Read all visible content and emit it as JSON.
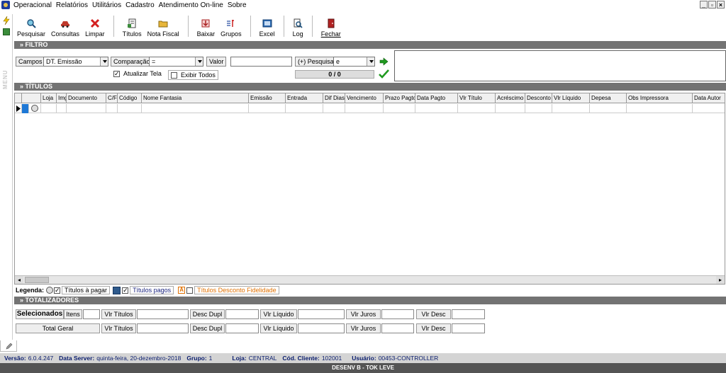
{
  "menu": {
    "items": [
      "Operacional",
      "Relatórios",
      "Utilitários",
      "Cadastro",
      "Atendimento On-line",
      "Sobre"
    ],
    "window_controls": [
      "_",
      "▫",
      "×"
    ]
  },
  "left_strip": {
    "vertical_label": "MENU"
  },
  "toolbar": {
    "groups": [
      [
        {
          "name": "pesquisar",
          "label": "Pesquisar",
          "icon": "search-icon"
        },
        {
          "name": "consultas",
          "label": "Consultas",
          "icon": "car-icon"
        },
        {
          "name": "limpar",
          "label": "Limpar",
          "icon": "red-x-icon"
        }
      ],
      [
        {
          "name": "titulos",
          "label": "Títulos",
          "icon": "document-icon"
        },
        {
          "name": "nota-fiscal",
          "label": "Nota Fiscal",
          "icon": "folder-icon"
        }
      ],
      [
        {
          "name": "baixar",
          "label": "Baixar",
          "icon": "download-icon"
        },
        {
          "name": "grupos",
          "label": "Grupos",
          "icon": "group-icon"
        }
      ],
      [
        {
          "name": "excel",
          "label": "Excel",
          "icon": "excel-icon"
        }
      ],
      [
        {
          "name": "log",
          "label": "Log",
          "icon": "magnifier-icon"
        }
      ],
      [
        {
          "name": "fechar",
          "label": "Fechar",
          "icon": "exit-icon"
        }
      ]
    ]
  },
  "filtro": {
    "section_title": "» FILTRO",
    "campos_label": "Campos",
    "campos_value": "DT. Emissão",
    "comparacao_label": "Comparação",
    "comparacao_value": "=",
    "valor_label": "Valor",
    "valor_value": "",
    "pesquisa_label": "(+) Pesquisa",
    "pesquisa_value": "e",
    "atualizar_label": "Atualizar Tela",
    "atualizar_checked": true,
    "exibir_label": "Exibir Todos",
    "exibir_checked": false,
    "counter": "0 / 0"
  },
  "titulos": {
    "section_title": "» TÍTULOS",
    "columns": [
      "",
      "",
      "Loja",
      "Img",
      "Documento",
      "C/F",
      "Código",
      "Nome Fantasia",
      "Emissão",
      "Entrada",
      "Dif Dias",
      "Vencimento",
      "Prazo Pagto",
      "Data Pagto",
      "Vlr Título",
      "Acréscimo",
      "Desconto",
      "Vlr Líquido",
      "Depesa",
      "Obs Impressora",
      "Data Autor"
    ]
  },
  "legend": {
    "title": "Legenda:",
    "item1": "Títulos à pagar",
    "item2": "Títulos pagos",
    "item3": "Títulos Desconto Fidelidade",
    "item3_glyph": "A",
    "check_glyph": "✓",
    "colors": {
      "pagos_text": "#1a237e",
      "fidelidade_text": "#e07000"
    }
  },
  "totalizadores": {
    "section_title": "» TOTALIZADORES",
    "selecionados_label": "Selecionados",
    "itens_label": "Itens",
    "total_geral_label": "Total Geral",
    "vlr_titulos_label": "Vlr Títulos",
    "desc_dupl_label": "Desc Dupl",
    "vlr_liquido_label": "Vlr Líquido",
    "vlr_juros_label": "Vlr Juros",
    "vlr_desc_label": "Vlr Desc"
  },
  "status": {
    "versao_label": "Versão:",
    "versao": "6.0.4.247",
    "data_server_label": "Data Server:",
    "data_server": "quinta-feira, 20-dezembro-2018",
    "grupo_label": "Grupo:",
    "grupo": "1",
    "loja_label": "Loja:",
    "loja": "CENTRAL",
    "cod_cliente_label": "Cód. Cliente:",
    "cod_cliente": "102001",
    "usuario_label": "Usuário:",
    "usuario": "00453-CONTROLLER"
  },
  "bottom": {
    "text": "DESENV B - TOK LEVE"
  }
}
